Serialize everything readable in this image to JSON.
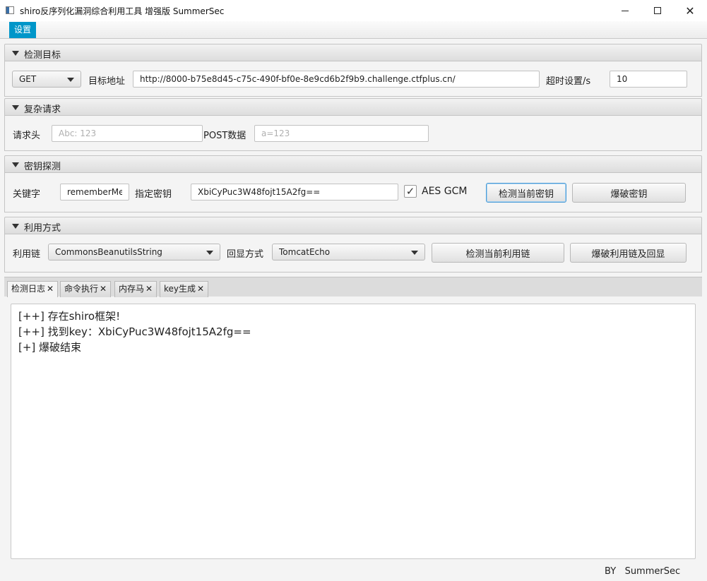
{
  "window": {
    "title": "shiro反序列化漏洞综合利用工具 增强版 SummerSec"
  },
  "menu": {
    "settings": "设置"
  },
  "detect_target": {
    "header": "检测目标",
    "method": "GET",
    "url_label": "目标地址",
    "url_value": "http://8000-b75e8d45-c75c-490f-bf0e-8e9cd6b2f9b9.challenge.ctfplus.cn/",
    "timeout_label": "超时设置/s",
    "timeout_value": "10"
  },
  "complex_request": {
    "header": "复杂请求",
    "headers_label": "请求头",
    "headers_placeholder": "Abc: 123",
    "post_label": "POST数据",
    "post_placeholder": "a=123"
  },
  "key_detection": {
    "header": "密钥探测",
    "keyword_label": "关键字",
    "keyword_value": "rememberMe",
    "key_label": "指定密钥",
    "key_value": "XbiCyPuc3W48fojt15A2fg==",
    "aes_gcm_label": "AES GCM",
    "aes_gcm_checked": true,
    "check_key_button": "检测当前密钥",
    "brute_key_button": "爆破密钥"
  },
  "exploit": {
    "header": "利用方式",
    "chain_label": "利用链",
    "chain_value": "CommonsBeanutilsString",
    "echo_label": "回显方式",
    "echo_value": "TomcatEcho",
    "check_chain_button": "检测当前利用链",
    "brute_chain_button": "爆破利用链及回显"
  },
  "tabs": [
    {
      "label": "检测日志",
      "active": true
    },
    {
      "label": "命令执行",
      "active": false
    },
    {
      "label": "内存马",
      "active": false
    },
    {
      "label": "key生成",
      "active": false
    }
  ],
  "tab_close_glyph": "✕",
  "log": [
    "[++] 存在shiro框架!",
    "[++] 找到key：XbiCyPuc3W48fojt15A2fg==",
    "[+] 爆破结束"
  ],
  "footer": {
    "by": "BY",
    "author": "SummerSec"
  },
  "colors": {
    "menu_accent": "#0096c9",
    "focus_border": "#4a9bd6"
  }
}
